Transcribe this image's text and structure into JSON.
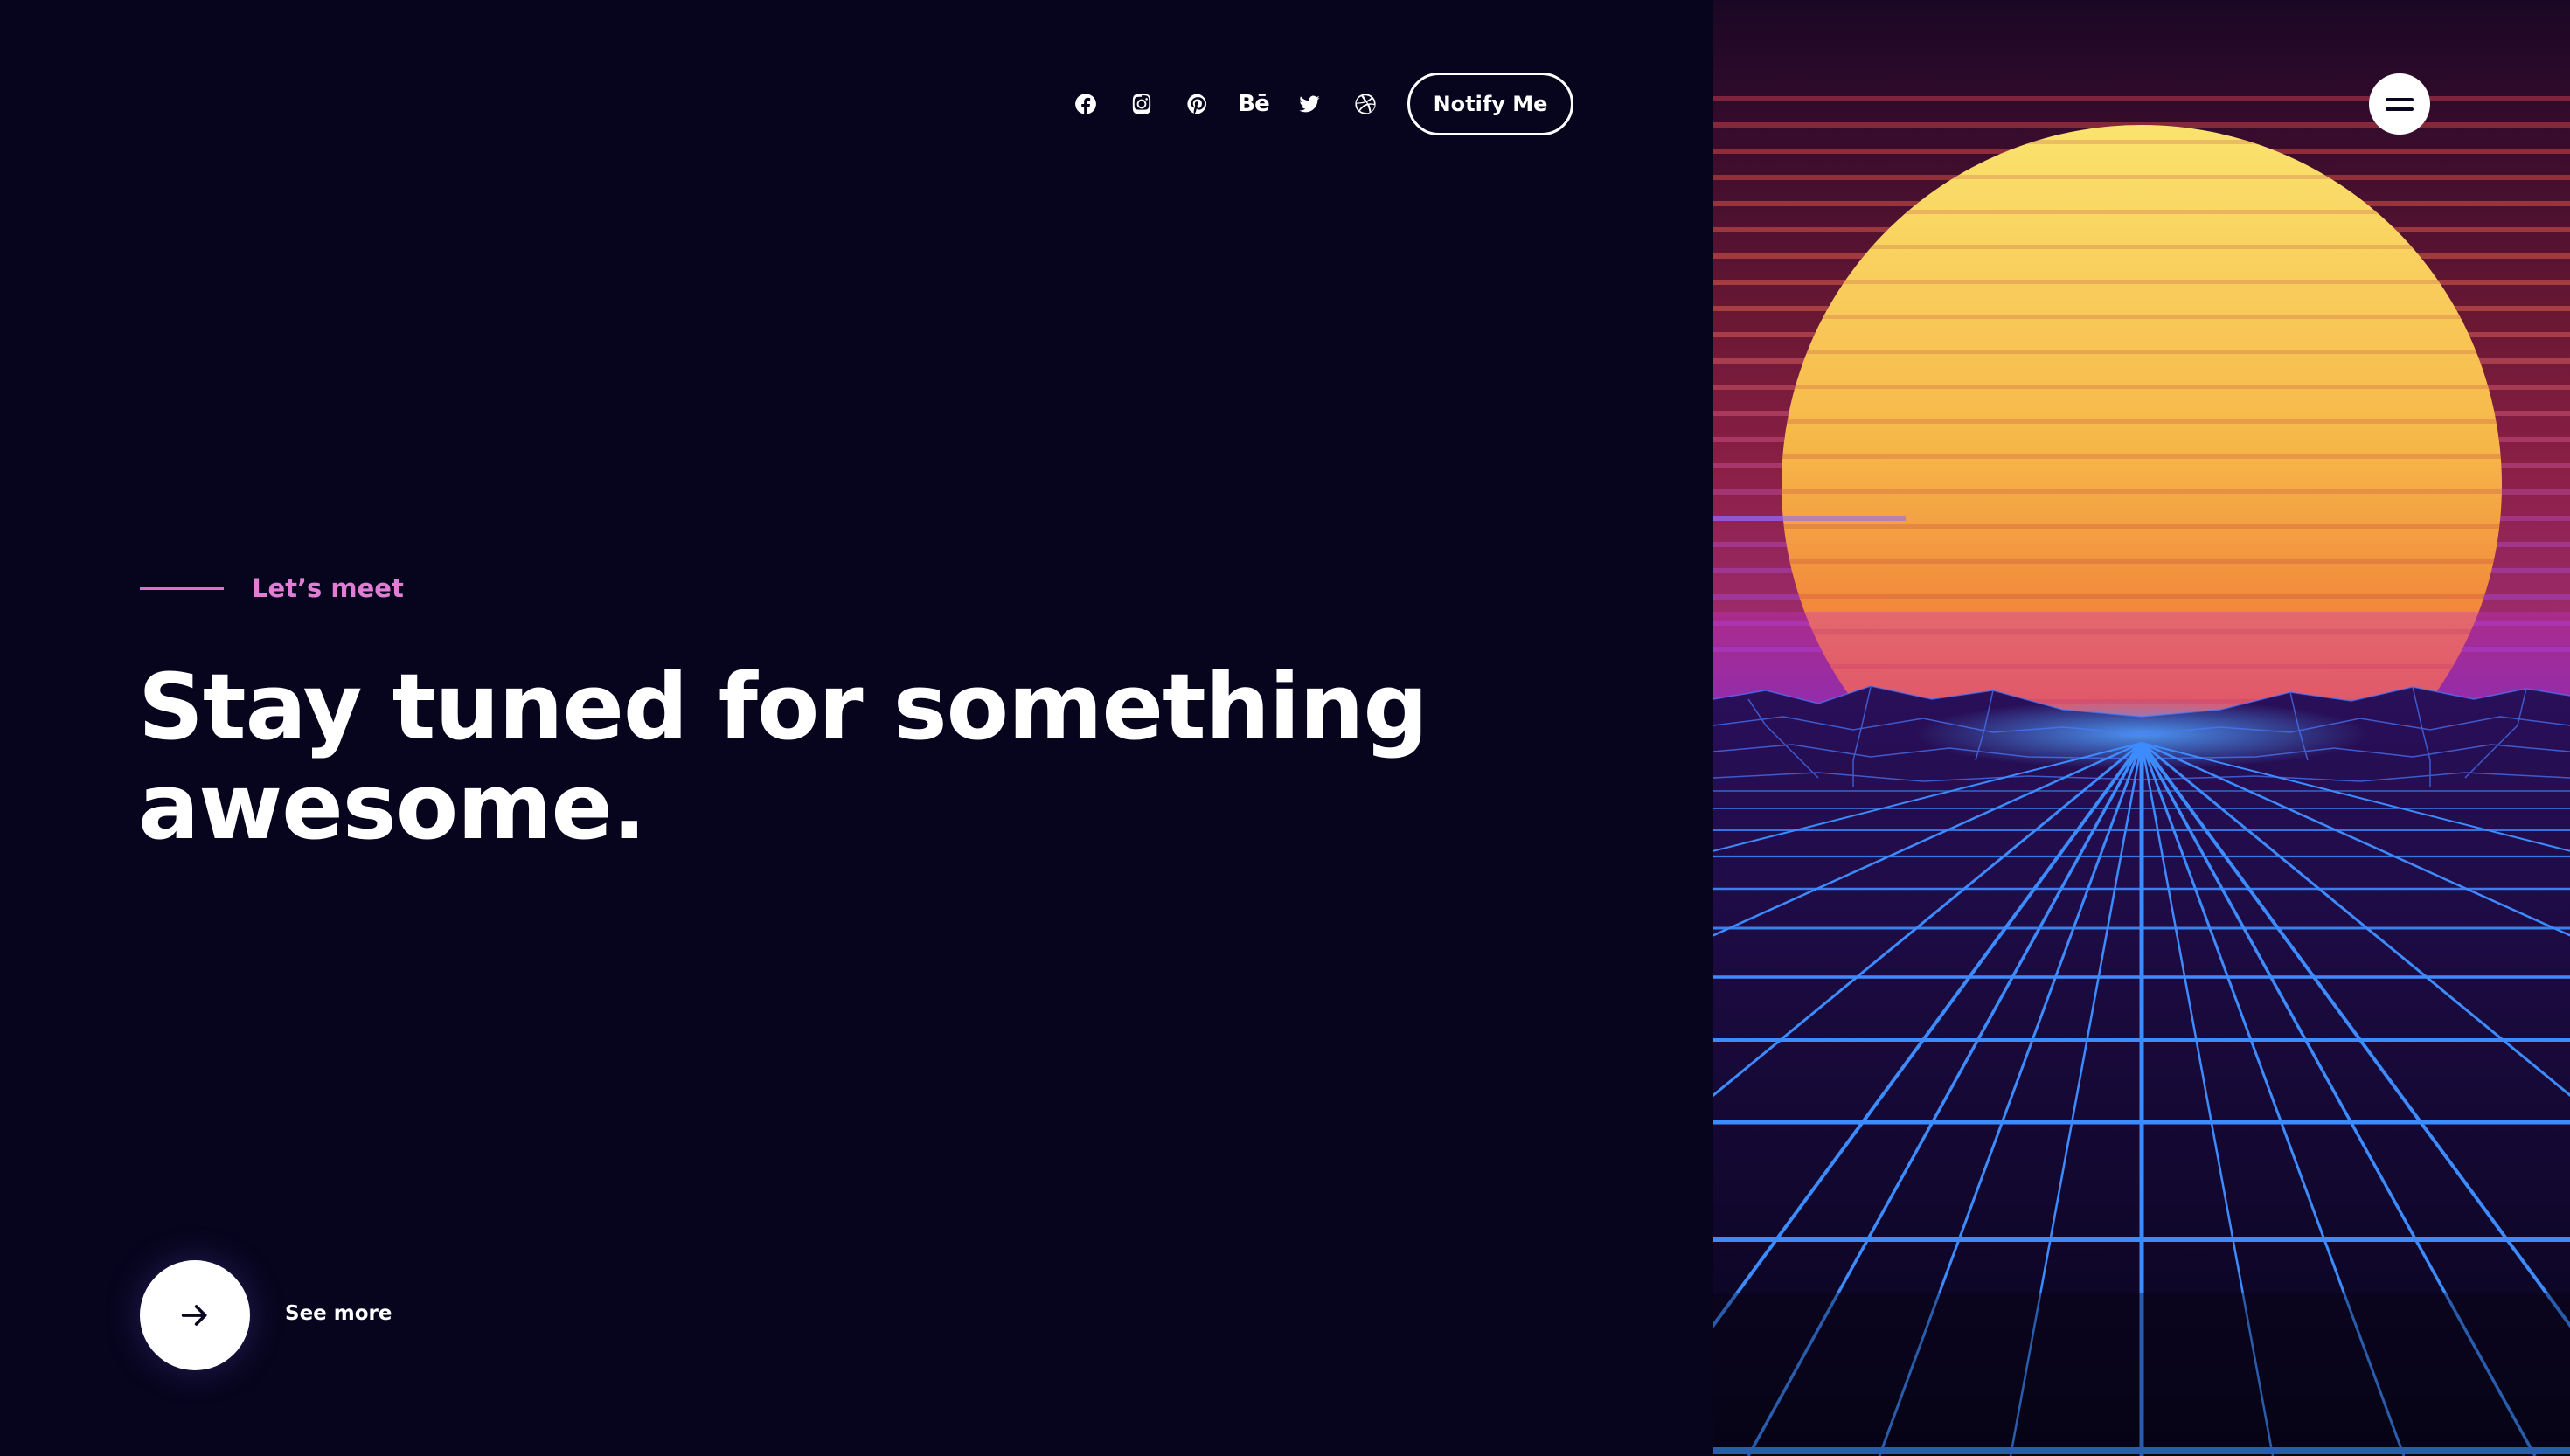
{
  "header": {
    "social_icons": [
      {
        "icon": "facebook-icon"
      },
      {
        "icon": "instagram-icon"
      },
      {
        "icon": "pinterest-icon"
      },
      {
        "icon": "behance-icon",
        "label": "Bē"
      },
      {
        "icon": "twitter-icon"
      },
      {
        "icon": "dribbble-icon"
      }
    ],
    "notify_label": "Notify Me",
    "menu_icon": "hamburger-menu-icon"
  },
  "hero": {
    "eyebrow": "Let’s meet",
    "headline_line1": "Stay tuned for something",
    "headline_line2": "awesome.",
    "see_more_label": "See more",
    "see_more_icon": "arrow-right-icon"
  },
  "colors": {
    "background": "#07051d",
    "accent": "#e07ed6",
    "text": "#ffffff",
    "grid": "#3b82f6",
    "sun_top": "#fbd96a",
    "sun_bottom": "#f0603a"
  }
}
